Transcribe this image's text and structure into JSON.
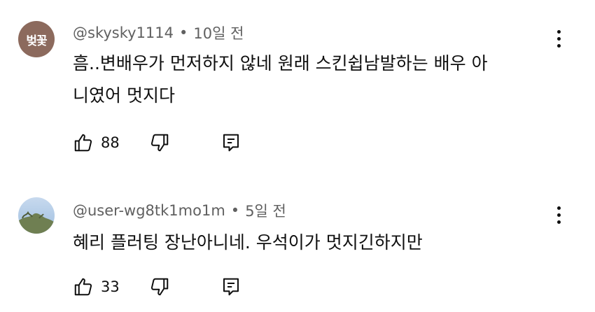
{
  "comments": [
    {
      "avatar_text": "벚꽃",
      "author": "@skysky1114",
      "separator": "•",
      "time": "10일 전",
      "text_line1": "흠..변배우가 먼저하지 않네 원래 스킨쉽남발하는 배우 아",
      "text_line2": "니였어 멋지다",
      "likes": "88",
      "avatar_color": "#8c6a5d"
    },
    {
      "author": "@user-wg8tk1mo1m",
      "separator": "•",
      "time": "5일 전",
      "text_line1": "혜리 플러팅 장난아니네. 우석이가 멋지긴하지만",
      "likes": "33"
    }
  ],
  "icons": {
    "like": "thumbs-up-icon",
    "dislike": "thumbs-down-icon",
    "reply": "reply-icon",
    "more": "more-vertical-icon"
  }
}
